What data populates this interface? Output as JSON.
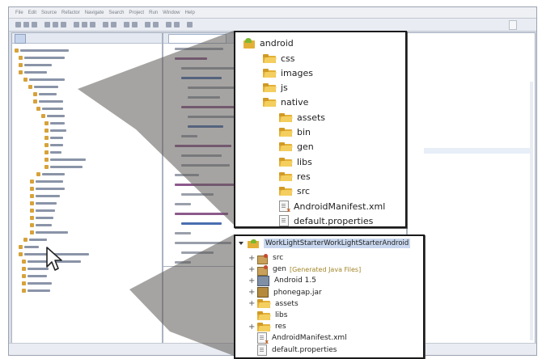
{
  "ide": {
    "menu_items": [
      "File",
      "Edit",
      "Source",
      "Refactor",
      "Navigate",
      "Search",
      "Project",
      "Run",
      "Window",
      "Help"
    ]
  },
  "popup_top": {
    "title": "android",
    "items": [
      {
        "label": "css",
        "icon": "folder-icon",
        "indent": 1
      },
      {
        "label": "images",
        "icon": "folder-icon",
        "indent": 1
      },
      {
        "label": "js",
        "icon": "folder-icon",
        "indent": 1
      },
      {
        "label": "native",
        "icon": "folder-icon",
        "indent": 1
      },
      {
        "label": "assets",
        "icon": "folder-icon",
        "indent": 2
      },
      {
        "label": "bin",
        "icon": "folder-icon",
        "indent": 2
      },
      {
        "label": "gen",
        "icon": "folder-icon",
        "indent": 2
      },
      {
        "label": "libs",
        "icon": "folder-icon",
        "indent": 2
      },
      {
        "label": "res",
        "icon": "folder-icon",
        "indent": 2
      },
      {
        "label": "src",
        "icon": "folder-icon",
        "indent": 2
      },
      {
        "label": "AndroidManifest.xml",
        "icon": "xml-file-icon",
        "indent": 2
      },
      {
        "label": "default.properties",
        "icon": "file-icon",
        "indent": 2
      }
    ]
  },
  "popup_bottom": {
    "title": "WorkLightStarterWorkLightStarterAndroid",
    "items": [
      {
        "label": "src",
        "icon": "package-folder-icon",
        "expander": "+"
      },
      {
        "label": "gen",
        "suffix": "[Generated Java Files]",
        "icon": "package-folder-icon",
        "expander": "+"
      },
      {
        "label": "Android 1.5",
        "icon": "library-icon",
        "expander": "+"
      },
      {
        "label": "phonegap.jar",
        "icon": "jar-icon",
        "expander": "+"
      },
      {
        "label": "assets",
        "icon": "folder-icon",
        "expander": "+"
      },
      {
        "label": "libs",
        "icon": "folder-icon",
        "expander": ""
      },
      {
        "label": "res",
        "icon": "folder-icon",
        "expander": "+"
      },
      {
        "label": "AndroidManifest.xml",
        "icon": "xml-file-icon",
        "expander": ""
      },
      {
        "label": "default.properties",
        "icon": "file-icon",
        "expander": ""
      }
    ]
  },
  "colors": {
    "folder": "#e3b037",
    "android_green": "#7cb82f",
    "callout_shadow": "#5d5a55",
    "generated_text": "#a2862a"
  }
}
